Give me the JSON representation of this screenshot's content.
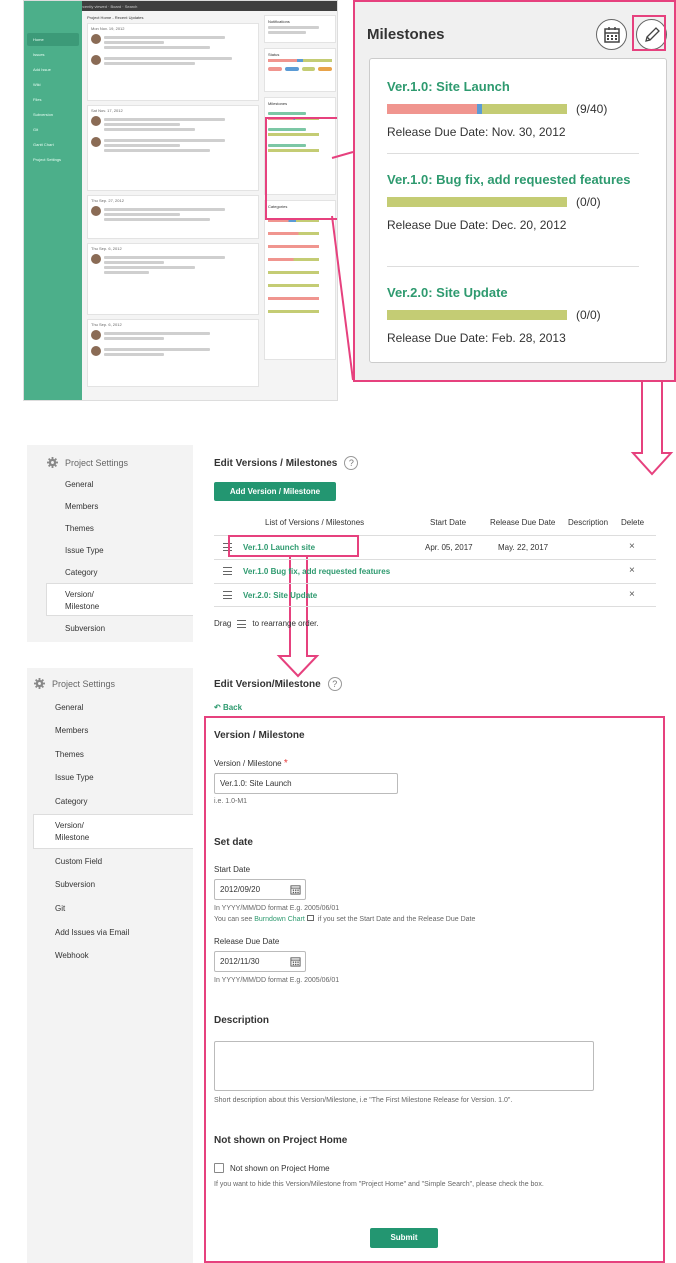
{
  "mini": {
    "topbar_text": "Backlog · Projects · Recently viewed · Board · Search",
    "nav": [
      "Home",
      "Issues",
      "Add Issue",
      "Wiki",
      "Files",
      "Subversion",
      "Git",
      "Gantt Chart",
      "Project Settings"
    ],
    "feed_title": "Project Home - Recent Updates",
    "dates": [
      "Mon Nov. 19, 2012",
      "Sat Nov. 17, 2012",
      "Thu Sep. 27, 2012",
      "Thu Sep. 6, 2012",
      "Thu Sep. 6, 2012"
    ],
    "right_cards": [
      "Notifications",
      "Status",
      "Milestones",
      "Categories"
    ]
  },
  "milestones_panel": {
    "title": "Milestones",
    "calendar_icon": "calendar-icon",
    "edit_icon": "pencil-icon",
    "items": [
      {
        "name": "Ver.1.0: Site Launch",
        "count": "(9/40)",
        "due": "Release Due Date: Nov. 30, 2012",
        "closed": 0.5,
        "in_progress": 0.03,
        "open": 0.47
      },
      {
        "name": "Ver.1.0: Bug fix, add requested features",
        "count": "(0/0)",
        "due": "Release Due Date: Dec. 20, 2012",
        "closed": 0,
        "in_progress": 0,
        "open": 1
      },
      {
        "name": "Ver.2.0: Site Update",
        "count": "(0/0)",
        "due": "Release Due Date: Feb. 28, 2013",
        "closed": 0,
        "in_progress": 0,
        "open": 1
      }
    ]
  },
  "settings_nav1": {
    "header": "Project Settings",
    "items": [
      "General",
      "Members",
      "Themes",
      "Issue Type",
      "Category",
      "Version/\nMilestone",
      "Subversion"
    ]
  },
  "versions_list": {
    "title": "Edit Versions / Milestones",
    "help": "?",
    "add_button": "Add Version / Milestone",
    "columns": {
      "list": "List of Versions / Milestones",
      "start": "Start Date",
      "due": "Release Due Date",
      "desc": "Description",
      "del": "Delete"
    },
    "rows": [
      {
        "name": "Ver.1.0 Launch site",
        "start": "Apr. 05, 2017",
        "due": "May. 22, 2017",
        "del": "×"
      },
      {
        "name": "Ver.1.0 Bug fix, add requested features",
        "start": "",
        "due": "",
        "del": "×"
      },
      {
        "name": "Ver.2.0: Site Update",
        "start": "",
        "due": "",
        "del": "×"
      }
    ],
    "drag_hint_a": "Drag",
    "drag_hint_b": "to rearrange order."
  },
  "settings_nav2": {
    "header": "Project Settings",
    "items": [
      "General",
      "Members",
      "Themes",
      "Issue Type",
      "Category",
      "Version/\nMilestone",
      "Custom Field",
      "Subversion",
      "Git",
      "Add Issues via Email",
      "Webhook"
    ]
  },
  "edit_form": {
    "title": "Edit Version/Milestone",
    "help": "?",
    "back": "Back",
    "sec_version": "Version / Milestone",
    "name_label": "Version / Milestone",
    "required": "*",
    "name_value": "Ver.1.0: Site Launch",
    "name_hint": "i.e. 1.0-M1",
    "sec_date": "Set date",
    "start_label": "Start Date",
    "start_value": "2012/09/20",
    "start_hint": "In YYYY/MM/DD format E.g. 2005/06/01",
    "burndown_a": "You can see",
    "burndown_link": "Burndown Chart",
    "burndown_b": "if you set the Start Date and the Release Due Date",
    "due_label": "Release Due Date",
    "due_value": "2012/11/30",
    "due_hint": "In YYYY/MM/DD format E.g. 2005/06/01",
    "sec_desc": "Description",
    "desc_hint": "Short description about this Version/Milestone, i.e \"The First Milestone Release for Version. 1.0\".",
    "sec_hidden": "Not shown on Project Home",
    "hidden_label": "Not shown on Project Home",
    "hidden_hint": "If you want to hide this Version/Milestone from \"Project Home\" and \"Simple Search\", please check the box.",
    "submit": "Submit"
  },
  "colors": {
    "accent": "#239671",
    "highlight": "#e6417e",
    "bar_closed": "#f0958f",
    "bar_progress": "#5b9bd5",
    "bar_open": "#c4cc74"
  }
}
